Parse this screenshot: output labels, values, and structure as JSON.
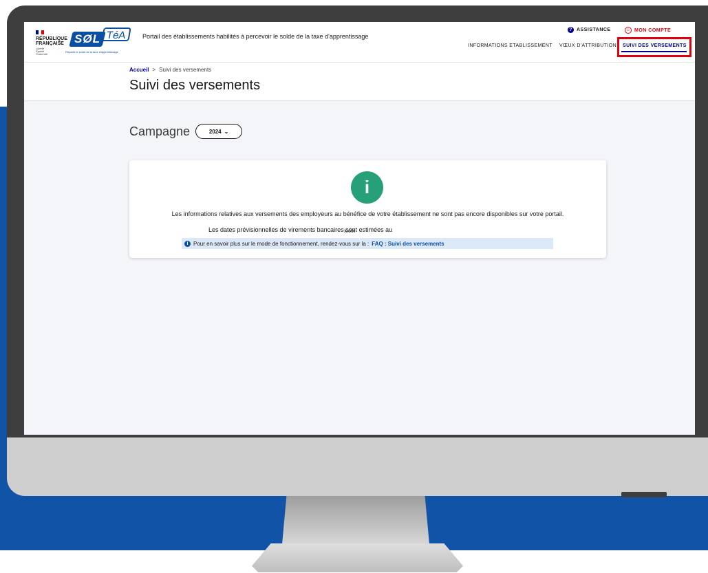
{
  "header": {
    "republic": "RÉPUBLIQUE\nFRANÇAISE",
    "motto": "Liberté\nÉgalité\nFraternité",
    "logo_sol": "SØL",
    "logo_tea": "TéA",
    "logo_tagline": "Répartir le solde de la taxe d'apprentissage",
    "portal_title": "Portail des établissements habilités à percevoir le solde de la taxe d'apprentissage",
    "assistance": "ASSISTANCE",
    "account": "MON COMPTE",
    "nav": [
      "INFORMATIONS ETABLISSEMENT",
      "VŒUX D'ATTRIBUTION",
      "SUIVI DES VERSEMENTS"
    ]
  },
  "breadcrumb": {
    "home": "Accueil",
    "separator": ">",
    "current": "Suivi des versements"
  },
  "page_title": "Suivi des versements",
  "campaign": {
    "label": "Campagne",
    "selected": "2024"
  },
  "card": {
    "icon": "i",
    "message": "Les informations relatives aux versements des employeurs au bénéfice de votre établissement ne sont pas encore disponibles sur votre portail.",
    "dates_label": "Les dates prévisionnelles de virements bancaires sont estimées au",
    "dates_value": "xxxx",
    "faq_text": "Pour en savoir plus sur le mode de fonctionnement, rendez-vous sur la :",
    "faq_link": "FAQ : Suivi des versements"
  },
  "colors": {
    "accent": "#000091",
    "highlight": "#e1000f",
    "info_green": "#26a078",
    "backdrop": "#1154a7"
  }
}
